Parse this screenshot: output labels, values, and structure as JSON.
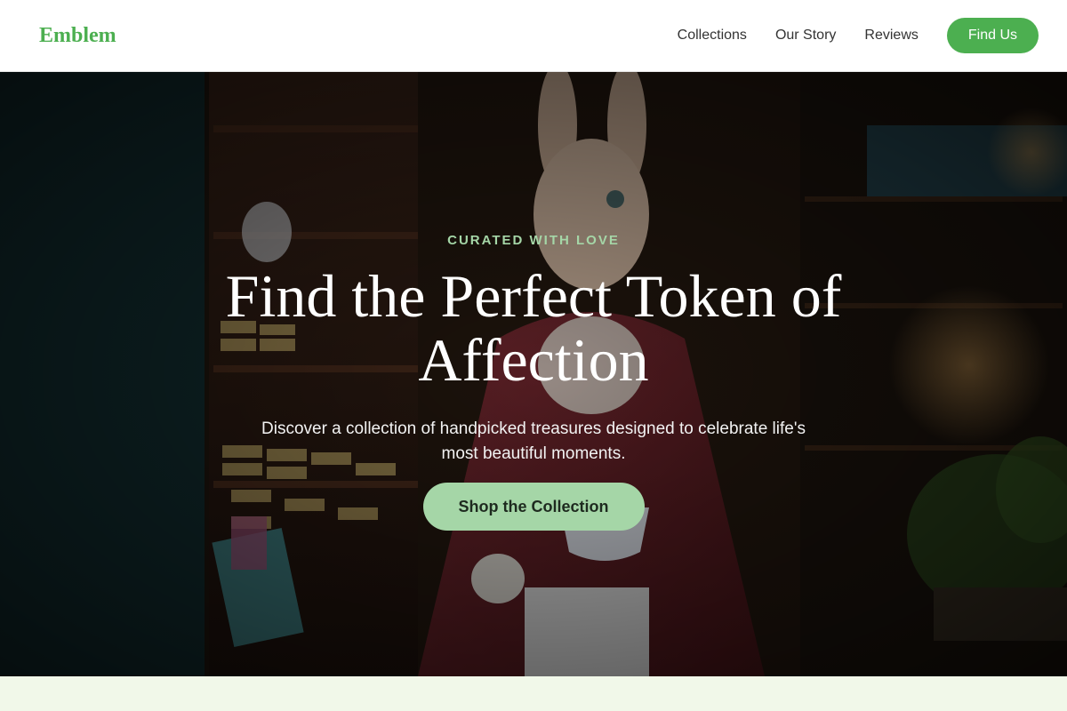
{
  "header": {
    "logo": "Emblem",
    "nav": [
      "Collections",
      "Our Story",
      "Reviews"
    ],
    "cta_label": "Find Us"
  },
  "hero": {
    "eyebrow": "CURATED WITH LOVE",
    "headline": "Find the Perfect Token of Affection",
    "subtext": "Discover a collection of handpicked treasures designed to celebrate life's most beautiful moments.",
    "button_label": "Shop the Collection",
    "background_image": "shop-interior-with-rabbit-statue"
  },
  "colors": {
    "accent": "#4caf50",
    "accent_light": "#a5d6a7",
    "band": "#f1f8e9"
  }
}
